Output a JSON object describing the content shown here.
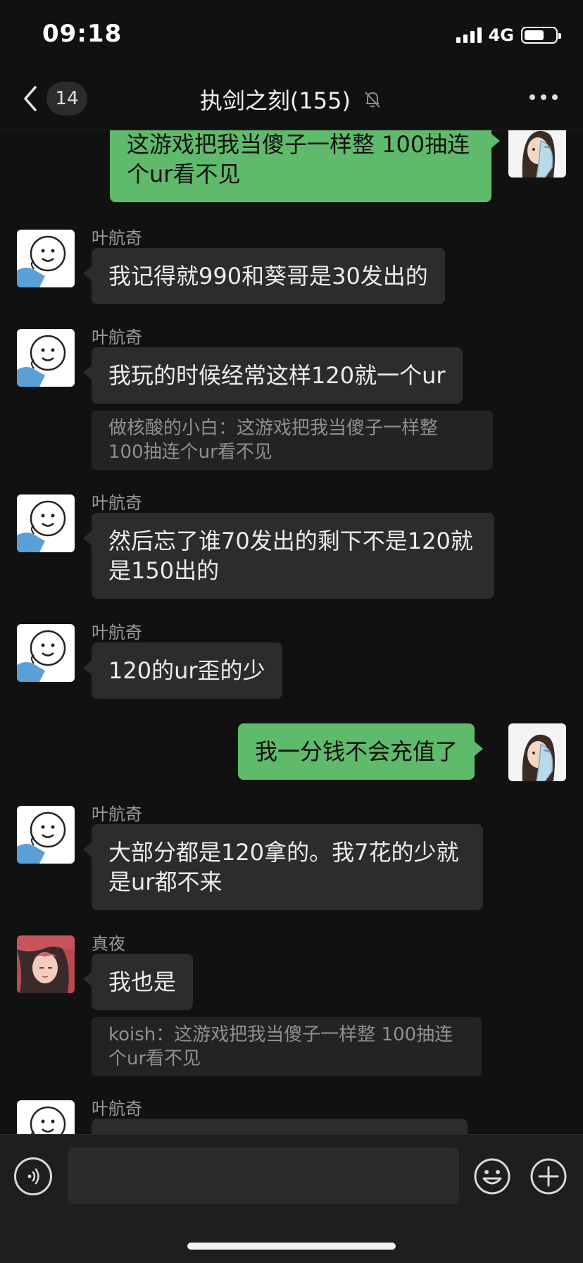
{
  "status_bar": {
    "time": "09:18",
    "network": "4G",
    "battery_level": 0.65,
    "signal_bars": 4
  },
  "nav": {
    "unread_count": "14",
    "title": "执剑之刻(155)"
  },
  "messages": [
    {
      "side": "right",
      "text": "这游戏把我当傻子一样整  100抽连个ur看不见"
    },
    {
      "side": "left",
      "sender": "叶航奇",
      "text": "我记得就990和葵哥是30发出的"
    },
    {
      "side": "left",
      "sender": "叶航奇",
      "text": "我玩的时候经常这样120就一个ur",
      "quote": "做核酸的小白：这游戏把我当傻子一样整  100抽连个ur看不见"
    },
    {
      "side": "left",
      "sender": "叶航奇",
      "text": "然后忘了谁70发出的剩下不是120就是150出的"
    },
    {
      "side": "left",
      "sender": "叶航奇",
      "text": "120的ur歪的少"
    },
    {
      "side": "right",
      "text": "我一分钱不会充值了"
    },
    {
      "side": "left",
      "sender": "叶航奇",
      "text": "大部分都是120拿的。我7花的少就是ur都不来"
    },
    {
      "side": "left",
      "sender": "真夜",
      "text": "我也是",
      "quote": "koish：这游戏把我当傻子一样整  100抽连个ur看不见"
    },
    {
      "side": "left",
      "sender": "叶航奇",
      "text": ""
    }
  ],
  "input": {
    "placeholder": ""
  },
  "colors": {
    "background": "#111111",
    "bubble_left": "#2c2c2c",
    "bubble_right": "#5fbb6b",
    "input_bar": "#1e1e1e"
  },
  "icons": {
    "back": "chevron-left-icon",
    "mute": "bell-off-icon",
    "more": "ellipsis-icon",
    "voice": "voice-icon",
    "emoji": "smiley-icon",
    "plus": "plus-icon"
  }
}
